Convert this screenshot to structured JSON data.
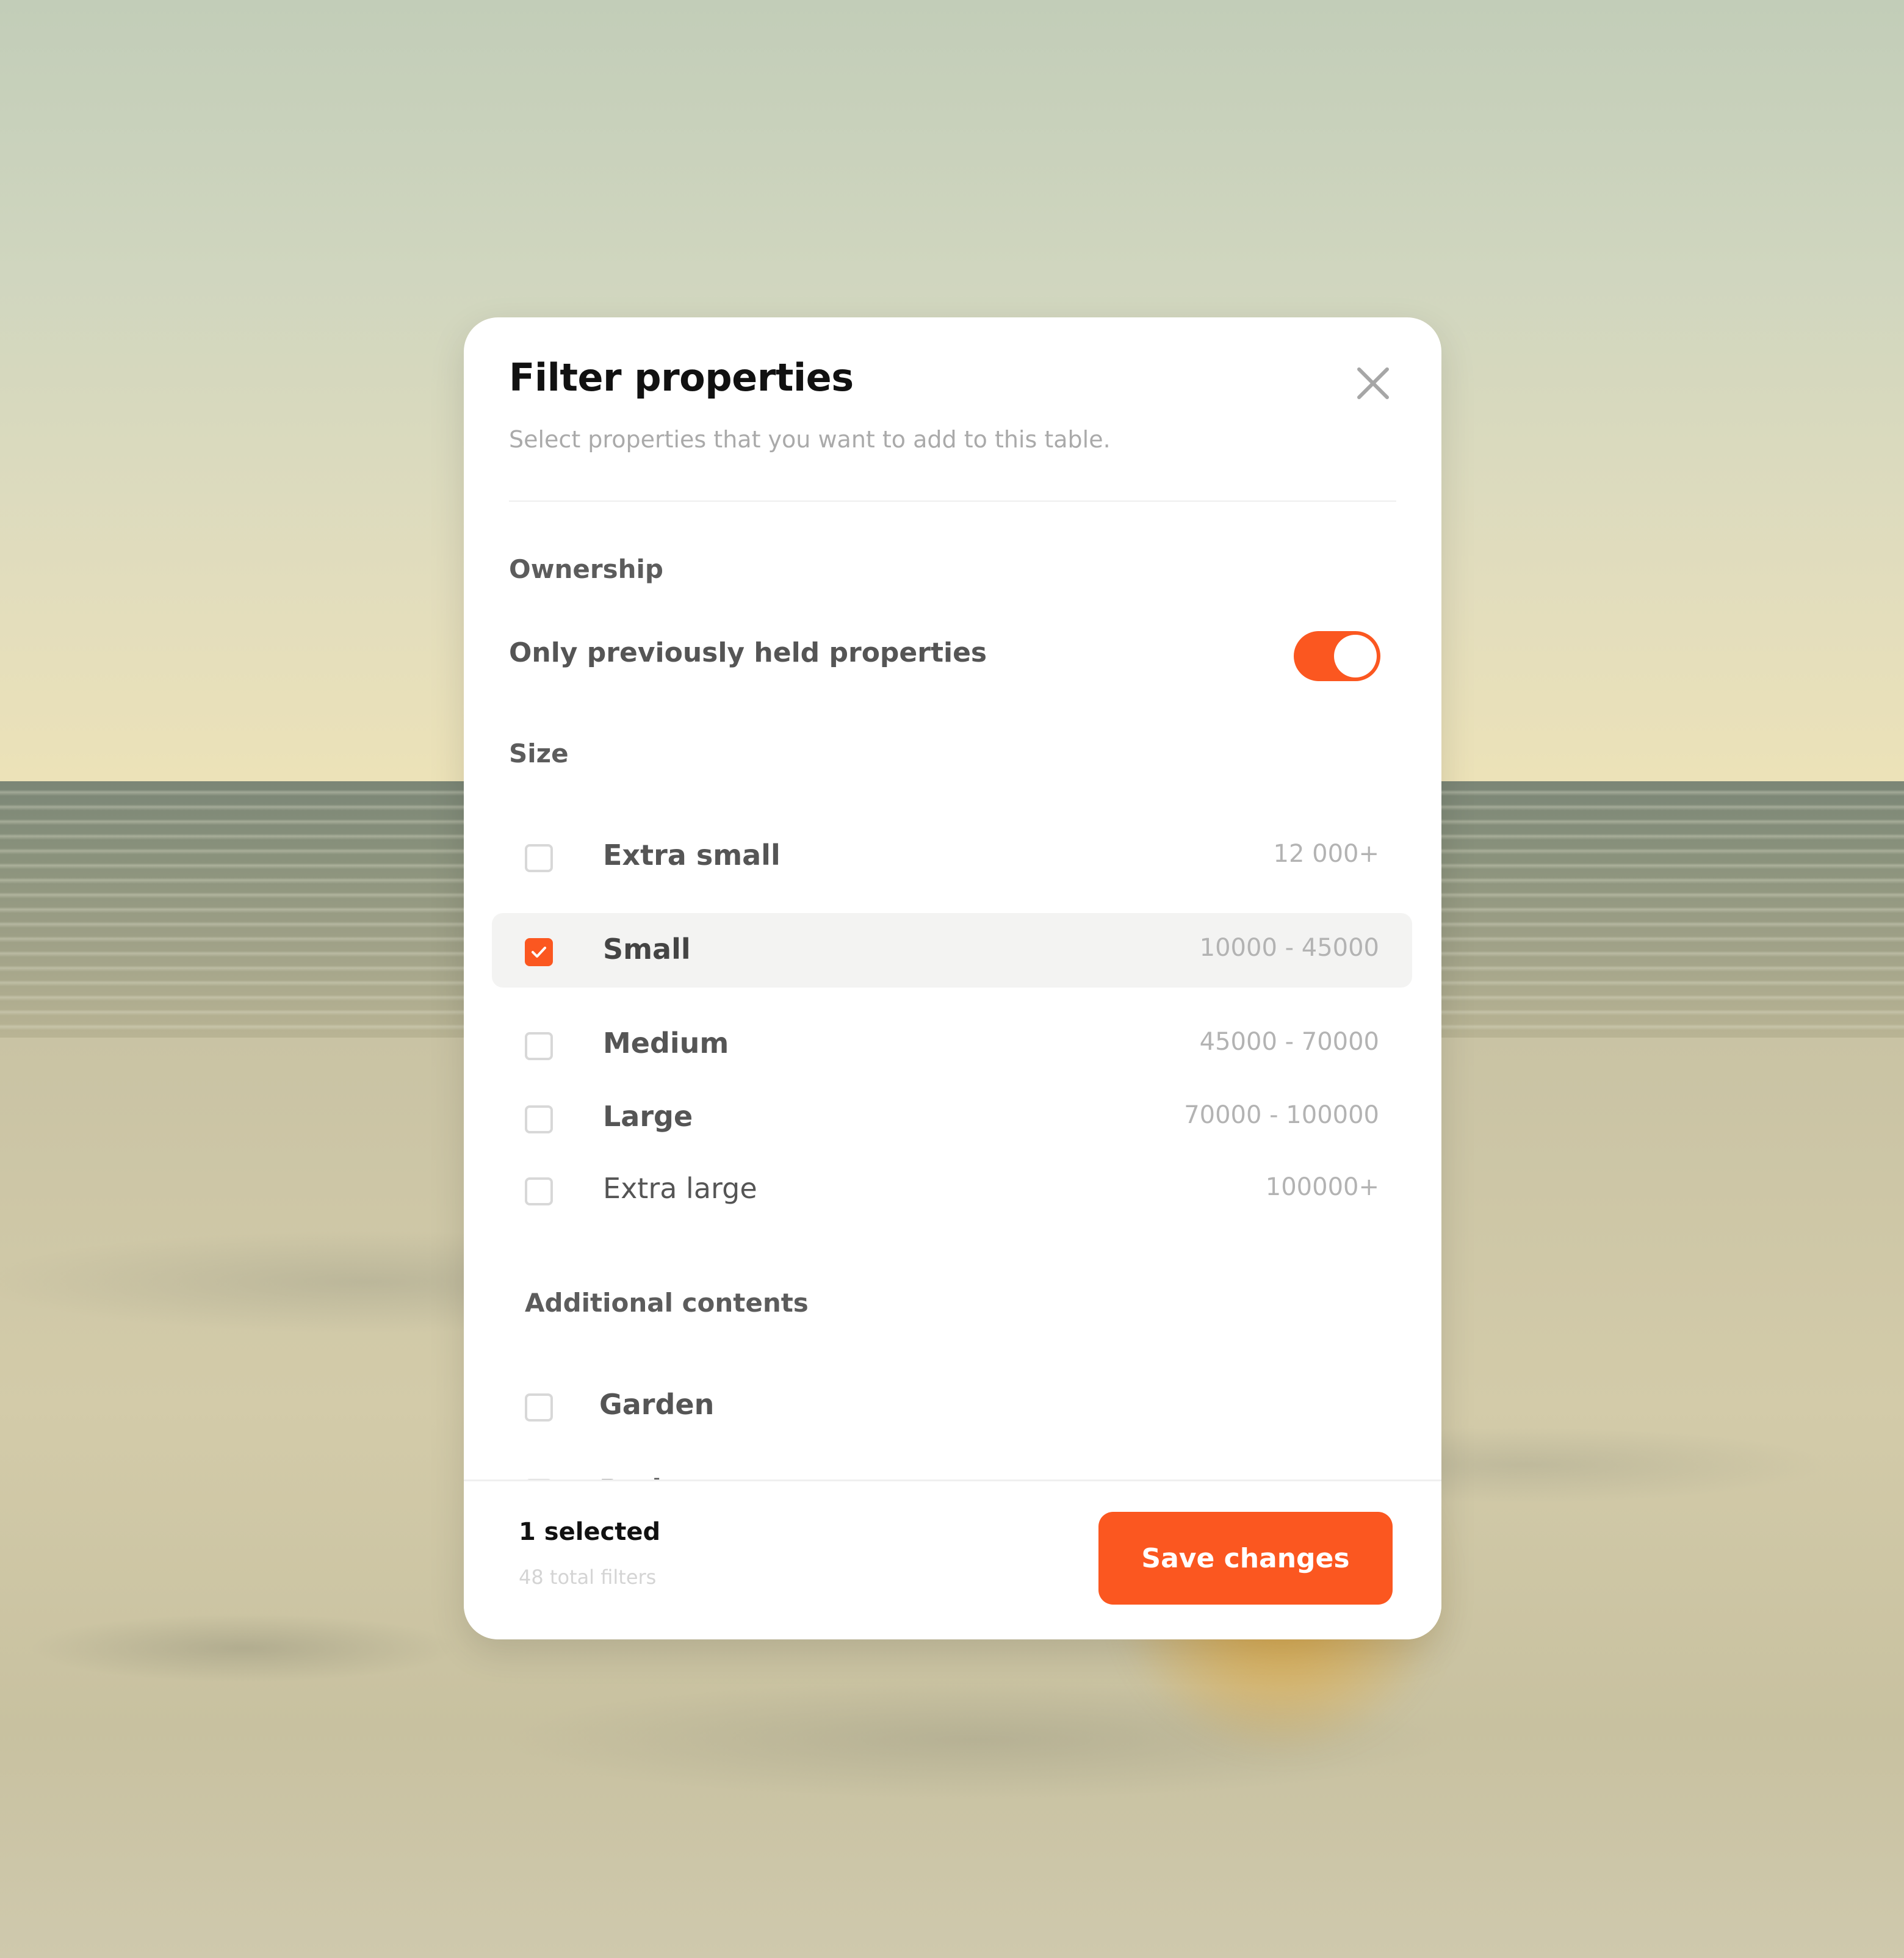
{
  "modal": {
    "title": "Filter properties",
    "subtitle": "Select properties that you want to add to this table.",
    "close_icon": "close-icon"
  },
  "ownership": {
    "heading": "Ownership",
    "toggle_label": "Only previously held properties",
    "toggle_on": true
  },
  "size": {
    "heading": "Size",
    "options": [
      {
        "label": "Extra small",
        "range": "12 000+",
        "checked": false
      },
      {
        "label": "Small",
        "range": "10000 - 45000",
        "checked": true
      },
      {
        "label": "Medium",
        "range": "45000 - 70000",
        "checked": false
      },
      {
        "label": "Large",
        "range": "70000 - 100000",
        "checked": false
      },
      {
        "label": "Extra large",
        "range": "100000+",
        "checked": false
      }
    ]
  },
  "additional": {
    "heading": "Additional contents",
    "options": [
      {
        "label": "Garden",
        "checked": false
      },
      {
        "label": "Parks",
        "checked": false
      }
    ]
  },
  "footer": {
    "selected": "1 selected",
    "total": "48 total filters",
    "save_label": "Save changes"
  },
  "colors": {
    "accent": "#fb5720",
    "text_dark": "#111111",
    "text_muted": "#aaaaaa"
  }
}
